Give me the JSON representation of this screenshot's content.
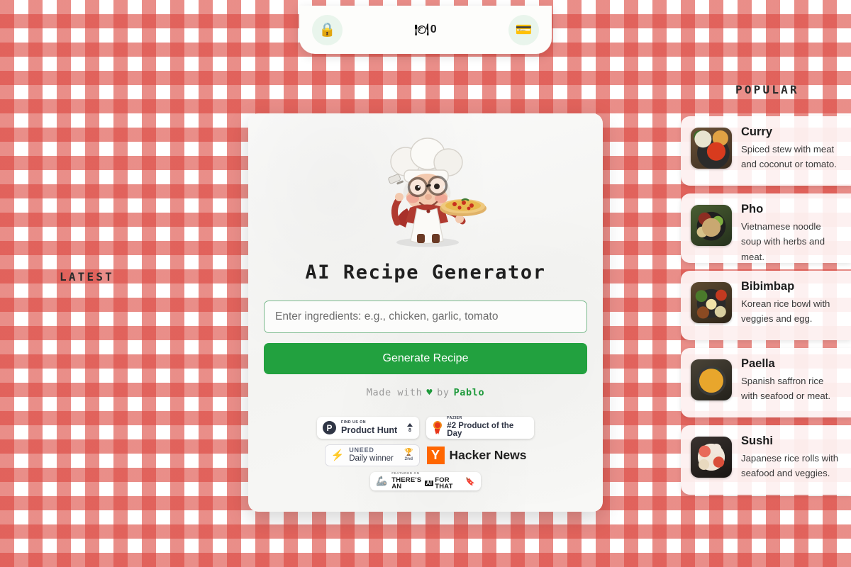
{
  "topbar": {
    "login_icon": "lock-icon",
    "login_glyph": "🔒",
    "credits_icon": "plate-cutlery-icon",
    "credits_glyph": "🍽",
    "credits_count": "0",
    "billing_icon": "credit-card-icon",
    "billing_glyph": "💳"
  },
  "side_labels": {
    "latest": "LATEST",
    "popular": "POPULAR"
  },
  "card": {
    "mascot_name": "grandma-chef-illustration",
    "title": "AI Recipe Generator",
    "input_placeholder": "Enter ingredients: e.g., chicken, garlic, tomato",
    "input_value": "",
    "generate_label": "Generate Recipe",
    "credit_prefix": "Made with",
    "credit_heart": "♥",
    "credit_by": "by",
    "credit_author": "Pablo"
  },
  "badges": {
    "product_hunt": {
      "logo": "P",
      "kicker": "FIND US ON",
      "name": "Product Hunt",
      "upvotes": "8"
    },
    "fazier": {
      "kicker": "FAZIER",
      "name": "#2 Product of the Day"
    },
    "uneed": {
      "bolt": "⚡",
      "kicker": "UNEED",
      "name": "Daily winner",
      "trophy": "🏆",
      "rank": "2nd"
    },
    "hacker_news": {
      "logo": "Y",
      "name": "Hacker News"
    },
    "theres_an_ai": {
      "logo": "🦾",
      "kicker": "FEATURED ON",
      "name_before": "THERE'S AN",
      "name_ai": "AI",
      "name_after": "FOR THAT",
      "bookmark": "🔖"
    }
  },
  "popular": [
    {
      "name": "Curry",
      "description": "Spiced stew with meat and coconut or tomato.",
      "thumb": "curry-thumbnail"
    },
    {
      "name": "Pho",
      "description": "Vietnamese noodle soup with herbs and meat.",
      "thumb": "pho-thumbnail"
    },
    {
      "name": "Bibimbap",
      "description": "Korean rice bowl with veggies and egg.",
      "thumb": "bibimbap-thumbnail"
    },
    {
      "name": "Paella",
      "description": "Spanish saffron rice with seafood or meat.",
      "thumb": "paella-thumbnail"
    },
    {
      "name": "Sushi",
      "description": "Japanese rice rolls with seafood and veggies.",
      "thumb": "sushi-thumbnail"
    }
  ],
  "colors": {
    "gingham_red": "#dc4840",
    "accent_green": "#22a13f",
    "input_border": "#7cba8e",
    "topbar_btn_bg": "#e9f5ec",
    "card_bg": "#f7f7f5"
  }
}
